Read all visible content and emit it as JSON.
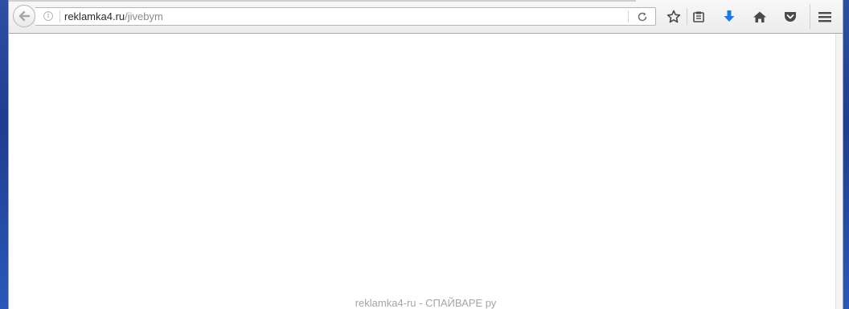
{
  "browser": {
    "url_host": "reklamka4.ru",
    "url_path": "/jivebym"
  },
  "toolbar": {
    "icons": [
      "back-arrow-icon",
      "info-icon",
      "reload-icon",
      "bookmark-star-icon",
      "reading-list-icon",
      "download-icon",
      "home-icon",
      "pocket-icon",
      "hamburger-menu-icon"
    ],
    "download_color": "#1a7ae6"
  },
  "page": {
    "footer_text": "reklamka4-ru - СПАЙВАРЕ ру"
  }
}
